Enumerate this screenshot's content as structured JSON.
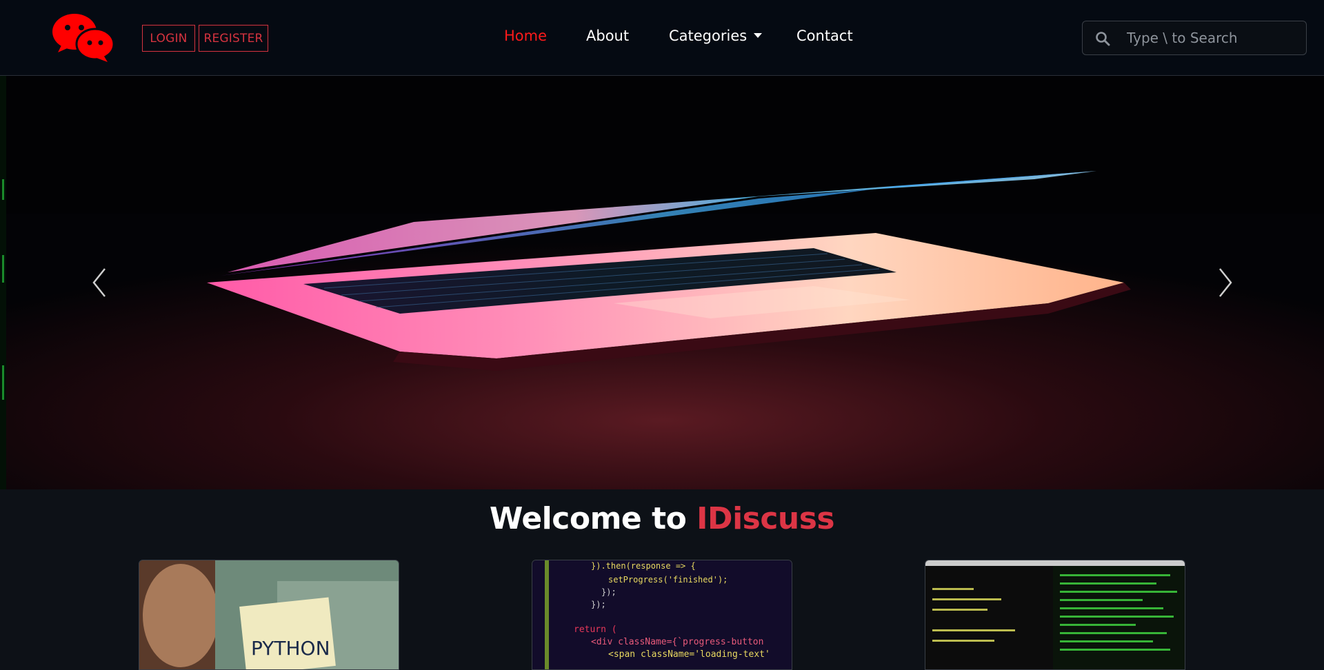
{
  "brand": {
    "logo_icon": "chat-bubbles-icon",
    "accent_color": "#ff0000"
  },
  "auth": {
    "login_label": "LOGIN",
    "register_label": "REGISTER"
  },
  "nav": {
    "items": [
      {
        "label": "Home",
        "active": true
      },
      {
        "label": "About",
        "active": false
      },
      {
        "label": "Categories",
        "active": false,
        "dropdown": true
      },
      {
        "label": "Contact",
        "active": false
      }
    ]
  },
  "search": {
    "placeholder": "Type \\ to Search",
    "value": ""
  },
  "carousel": {
    "prev_icon": "chevron-left-icon",
    "next_icon": "chevron-right-icon"
  },
  "welcome": {
    "prefix": "Welcome to ",
    "brand_name": "IDiscuss"
  },
  "cards": [
    {
      "image_text": "PYTHON"
    },
    {
      "image_text": "}).then(response => {"
    },
    {
      "image_text": ""
    }
  ],
  "colors": {
    "background": "#0d1117",
    "navbar": "#050a12",
    "accent_red": "#dc3545",
    "nav_active": "#ff1a1a"
  }
}
